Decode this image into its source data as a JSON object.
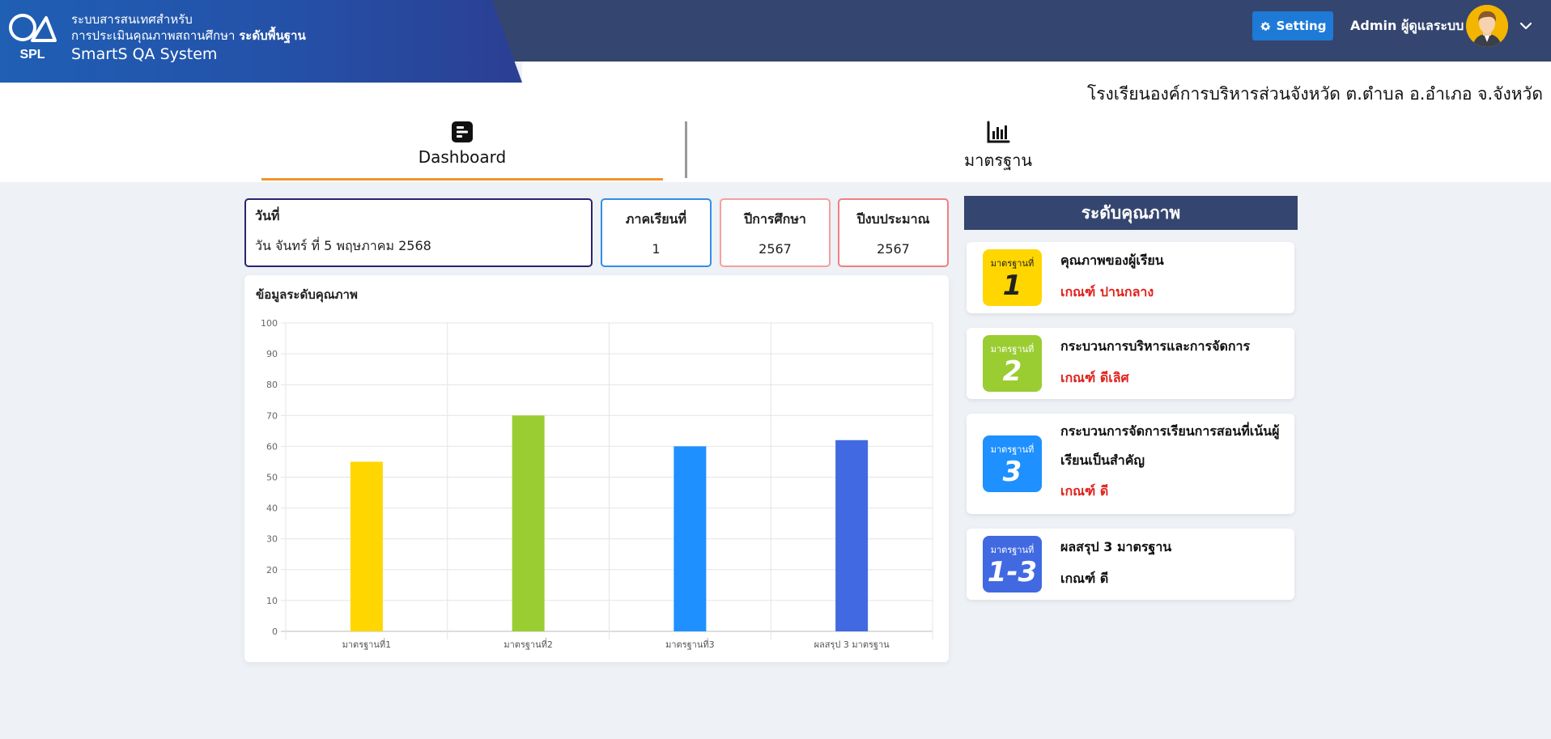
{
  "header": {
    "brand_line1": "ระบบสารสนเทศสำหรับ",
    "brand_line2_prefix": "การประเมินคุณภาพสถานศึกษา",
    "brand_line2_bold": "ระดับพื้นฐาน",
    "brand_line3": "SmartS QA System",
    "logo_text": "SPL",
    "setting_label": "Setting",
    "admin_name": "Admin ผู้ดูแลระบบ",
    "school_name": "โรงเรียนองค์การบริหารส่วนจังหวัด ต.ตำบล อ.อำเภอ จ.จังหวัด"
  },
  "tabs": {
    "dashboard": "Dashboard",
    "standard": "มาตรฐาน"
  },
  "info": {
    "date_title": "วันที่",
    "date_value": "วัน จันทร์ ที่ 5 พฤษภาคม 2568",
    "term_title": "ภาคเรียนที่",
    "term_value": "1",
    "year_title": "ปีการศึกษา",
    "year_value": "2567",
    "budget_title": "ปีงบประมาณ",
    "budget_value": "2567"
  },
  "chart_title": "ข้อมูลระดับคุณภาพ",
  "chart_data": {
    "type": "bar",
    "categories": [
      "มาตรฐานที่1",
      "มาตรฐานที่2",
      "มาตรฐานที่3",
      "ผลสรุป 3 มาตรฐาน"
    ],
    "values": [
      55,
      70,
      60,
      62
    ],
    "colors": [
      "#ffd600",
      "#9acd32",
      "#1e90ff",
      "#4169e1"
    ],
    "ylim": [
      0,
      100
    ],
    "yticks": [
      0,
      10,
      20,
      30,
      40,
      50,
      60,
      70,
      80,
      90,
      100
    ],
    "grid": true
  },
  "panel": {
    "title": "ระดับคุณภาพ",
    "badge_label": "มาตรฐานที่",
    "standards": [
      {
        "num": "1",
        "name": "คุณภาพของผู้เรียน",
        "grade": "เกณฑ์ ปานกลาง",
        "color": "#ffd600",
        "grade_color": "#e0221c"
      },
      {
        "num": "2",
        "name": "กระบวนการบริหารและการจัดการ",
        "grade": "เกณฑ์ ดีเลิศ",
        "color": "#9acd32",
        "grade_color": "#e0221c"
      },
      {
        "num": "3",
        "name_line1": "กระบวนการจัดการเรียนการสอนที่เน้นผู้",
        "name_line2": "เรียนเป็นสำคัญ",
        "grade": "เกณฑ์ ดี",
        "color": "#1e90ff",
        "grade_color": "#e0221c"
      },
      {
        "num": "1-3",
        "name": "ผลสรุป 3 มาตรฐาน",
        "grade": "เกณฑ์ ดี",
        "color": "#4169e1",
        "grade_color": "#111111"
      }
    ]
  },
  "icons": {
    "settings": "gear-icon",
    "dashboard": "dashboard-icon",
    "standard": "bar-chart-icon",
    "menu": "chevron-down-icon"
  }
}
